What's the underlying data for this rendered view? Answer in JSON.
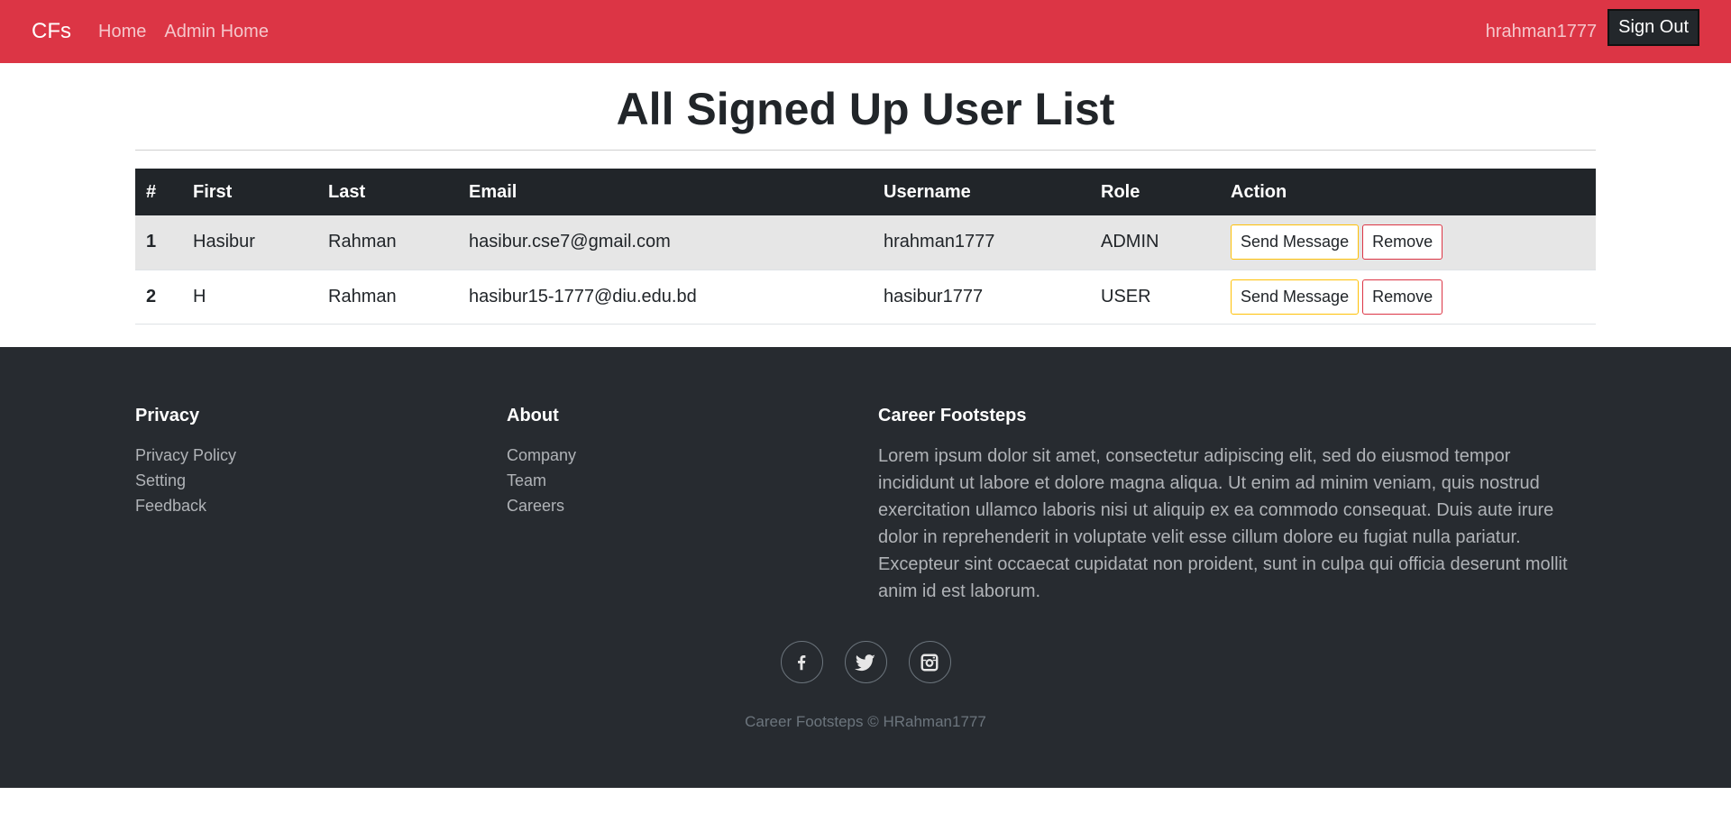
{
  "navbar": {
    "brand": "CFs",
    "links": [
      "Home",
      "Admin Home"
    ],
    "username": "hrahman1777",
    "signout_label": "Sign Out",
    "color": "#dc3545"
  },
  "main": {
    "title": "All Signed Up User List",
    "table": {
      "headers": [
        "#",
        "First",
        "Last",
        "Email",
        "Username",
        "Role",
        "Action"
      ],
      "rows": [
        {
          "num": "1",
          "first": "Hasibur",
          "last": "Rahman",
          "email": "hasibur.cse7@gmail.com",
          "username": "hrahman1777",
          "role": "ADMIN"
        },
        {
          "num": "2",
          "first": "H",
          "last": "Rahman",
          "email": "hasibur15-1777@diu.edu.bd",
          "username": "hasibur1777",
          "role": "USER"
        }
      ],
      "send_message_label": "Send Message",
      "remove_label": "Remove"
    }
  },
  "footer": {
    "privacy": {
      "heading": "Privacy",
      "links": [
        "Privacy Policy",
        "Setting",
        "Feedback"
      ]
    },
    "about": {
      "heading": "About",
      "links": [
        "Company",
        "Team",
        "Careers"
      ]
    },
    "career": {
      "heading": "Career Footsteps",
      "text": "Lorem ipsum dolor sit amet, consectetur adipiscing elit, sed do eiusmod tempor incididunt ut labore et dolore magna aliqua. Ut enim ad minim veniam, quis nostrud exercitation ullamco laboris nisi ut aliquip ex ea commodo consequat. Duis aute irure dolor in reprehenderit in voluptate velit esse cillum dolore eu fugiat nulla pariatur. Excepteur sint occaecat cupidatat non proident, sunt in culpa qui officia deserunt mollit anim id est laborum."
    },
    "social_icons": [
      "facebook-icon",
      "twitter-icon",
      "instagram-icon"
    ],
    "copyright": "Career Footsteps © HRahman1777"
  }
}
